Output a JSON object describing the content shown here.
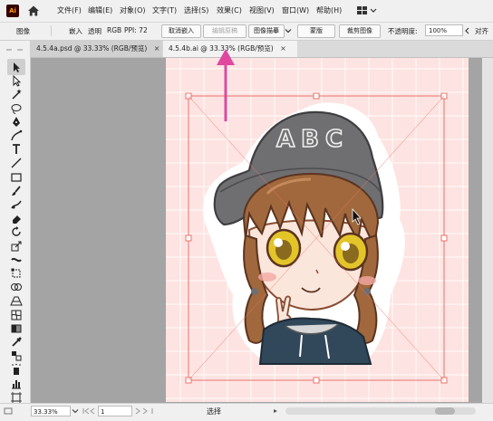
{
  "app": {
    "logo": "Ai"
  },
  "menu": [
    "文件(F)",
    "编辑(E)",
    "对象(O)",
    "文字(T)",
    "选择(S)",
    "效果(C)",
    "视图(V)",
    "窗口(W)",
    "帮助(H)"
  ],
  "control_bar": {
    "object_type": "图像",
    "link_info": "嵌入",
    "transparency_label": "透明",
    "color_mode": "RGB",
    "ppi_label": "PPI: 72",
    "unembed_button": "取消嵌入",
    "edit_original_button": "编辑原稿",
    "image_trace_button": "图像描摹",
    "mask_button": "蒙版",
    "crop_button": "裁剪图像",
    "opacity_label": "不透明度:",
    "opacity_value": "100%",
    "align_label": "对齐"
  },
  "tabs": [
    {
      "label": "4.5.4a.psd @ 33.33% (RGB/预览)",
      "close": "×",
      "active": false
    },
    {
      "label": "4.5.4b.ai @ 33.33% (RGB/预览)",
      "close": "×",
      "active": true
    }
  ],
  "artwork": {
    "hat_text": "ABC"
  },
  "status_bar": {
    "zoom": "33.33%",
    "page": "1",
    "status": "选择"
  },
  "colors": {
    "annotation_arrow": "#e0479e",
    "selection_box": "#e8766e",
    "artboard_bg": "#fde3e1",
    "canvas_bg": "#a4a4a4",
    "hat_gray": "#6f6f71",
    "hair_brown": "#a0683c"
  }
}
